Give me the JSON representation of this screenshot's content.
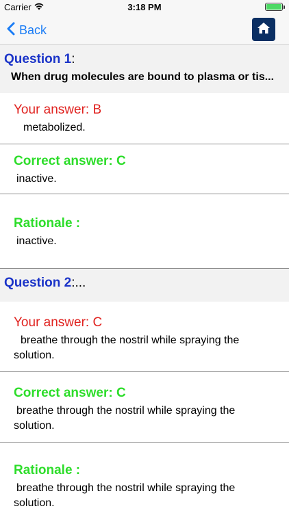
{
  "status": {
    "carrier": "Carrier",
    "time": "3:18 PM"
  },
  "nav": {
    "back_label": "Back"
  },
  "questions": [
    {
      "label": "Question 1",
      "suffix": ":",
      "text": "When drug molecules are bound to plasma or tis...",
      "your_answer_label": "Your answer: B",
      "your_answer_text": "metabolized.",
      "correct_answer_label": "Correct answer: C",
      "correct_answer_text": "inactive.",
      "rationale_label": "Rationale :",
      "rationale_text": "inactive."
    },
    {
      "label": "Question 2",
      "suffix": ":...",
      "your_answer_label": "Your answer: C",
      "your_answer_text": "breathe through the nostril while spraying the solution.",
      "correct_answer_label": "Correct answer: C",
      "correct_answer_text": "breathe through the nostril while spraying the solution.",
      "rationale_label": "Rationale :",
      "rationale_text": "breathe through the nostril while spraying the solution."
    }
  ],
  "colors": {
    "wrong": "#e0221f",
    "correct": "#2ddd2a",
    "question": "#1a33c8",
    "link": "#1a7cf5",
    "home_button": "#0b2f63"
  }
}
